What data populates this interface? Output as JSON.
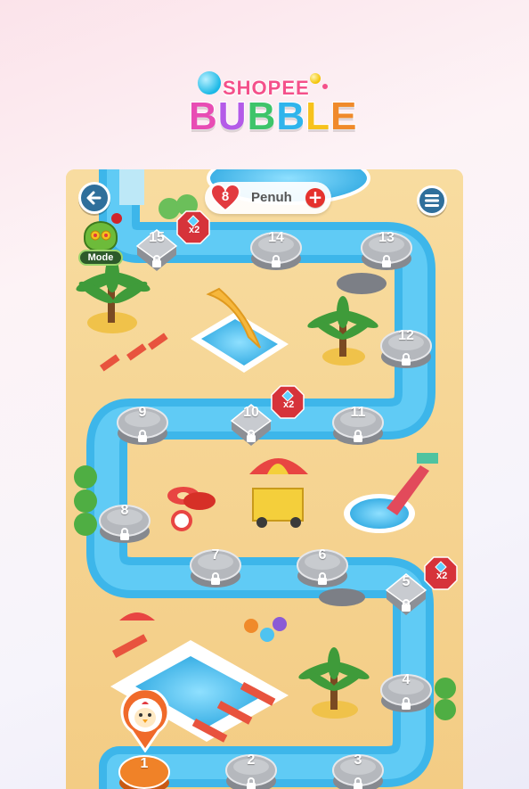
{
  "brand": {
    "logo_top": "SHOPEE",
    "logo_bottom_letters": [
      {
        "ch": "B",
        "color": "#e84db4"
      },
      {
        "ch": "U",
        "color": "#b45be8"
      },
      {
        "ch": "B",
        "color": "#3ec46a"
      },
      {
        "ch": "B",
        "color": "#2fb4ec"
      },
      {
        "ch": "L",
        "color": "#f7c21c"
      },
      {
        "ch": "E",
        "color": "#f08a2a"
      }
    ]
  },
  "hud": {
    "lives_count": "8",
    "lives_status": "Penuh",
    "add_life_label": "+",
    "mode_label": "Mode"
  },
  "levels": [
    {
      "number": "1",
      "state": "current"
    },
    {
      "number": "2",
      "state": "locked"
    },
    {
      "number": "3",
      "state": "locked"
    },
    {
      "number": "4",
      "state": "locked"
    },
    {
      "number": "5",
      "state": "locked",
      "bonus": "x2"
    },
    {
      "number": "6",
      "state": "locked"
    },
    {
      "number": "7",
      "state": "locked"
    },
    {
      "number": "8",
      "state": "locked"
    },
    {
      "number": "9",
      "state": "locked"
    },
    {
      "number": "10",
      "state": "locked",
      "bonus": "x2"
    },
    {
      "number": "11",
      "state": "locked"
    },
    {
      "number": "12",
      "state": "locked"
    },
    {
      "number": "13",
      "state": "locked"
    },
    {
      "number": "14",
      "state": "locked"
    },
    {
      "number": "15",
      "state": "locked",
      "bonus": "x2"
    }
  ],
  "colors": {
    "sand": "#f6d48f",
    "river": "#4fc3f0",
    "button_blue": "#2f6f9b",
    "heart_red": "#e23a3f",
    "current_level_orange": "#f08228"
  }
}
